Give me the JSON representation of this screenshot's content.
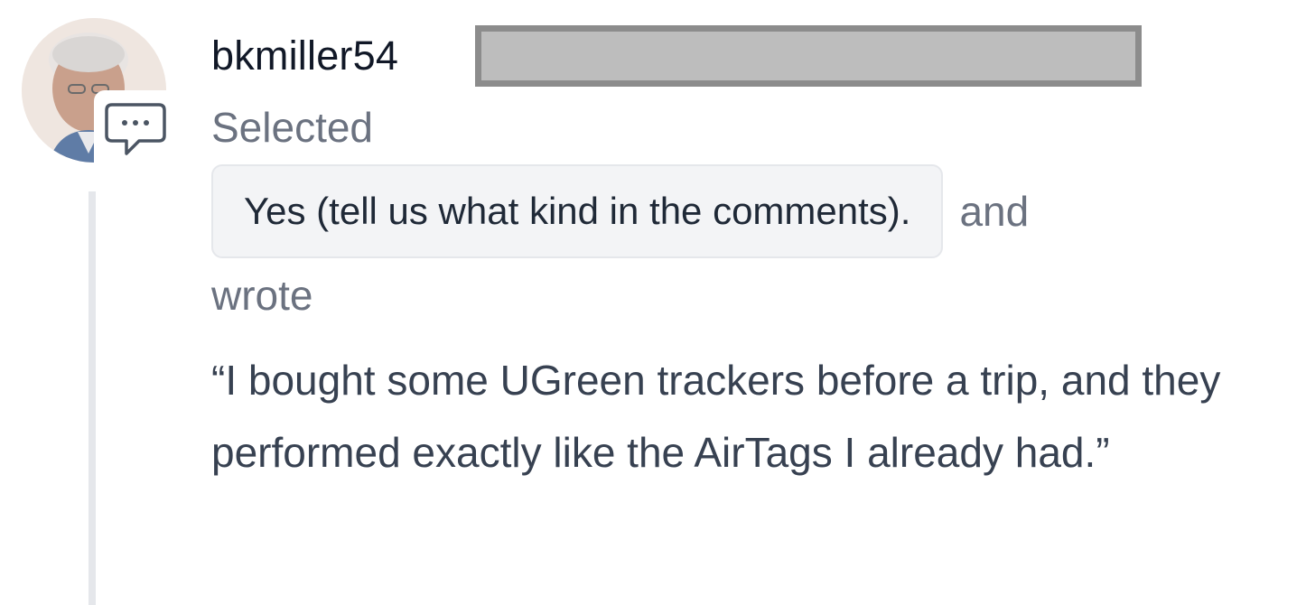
{
  "comment": {
    "avatar_icon": "user-photo",
    "badge_icon": "comment-bubble-icon",
    "username": "bkmiller54",
    "username_redacted": true,
    "selected_label": "Selected",
    "selected_choice": "Yes (tell us what kind in the comments).",
    "and_label": "and",
    "wrote_label": "wrote",
    "quote": "“I bought some UGreen trackers before a trip, and they performed exactly like the AirTags I already had.”"
  },
  "colors": {
    "text_primary": "#111827",
    "text_muted": "#6b7280",
    "chip_background": "#f3f4f6",
    "thread_line": "#e5e7eb",
    "redaction_fill": "#bdbdbd"
  }
}
